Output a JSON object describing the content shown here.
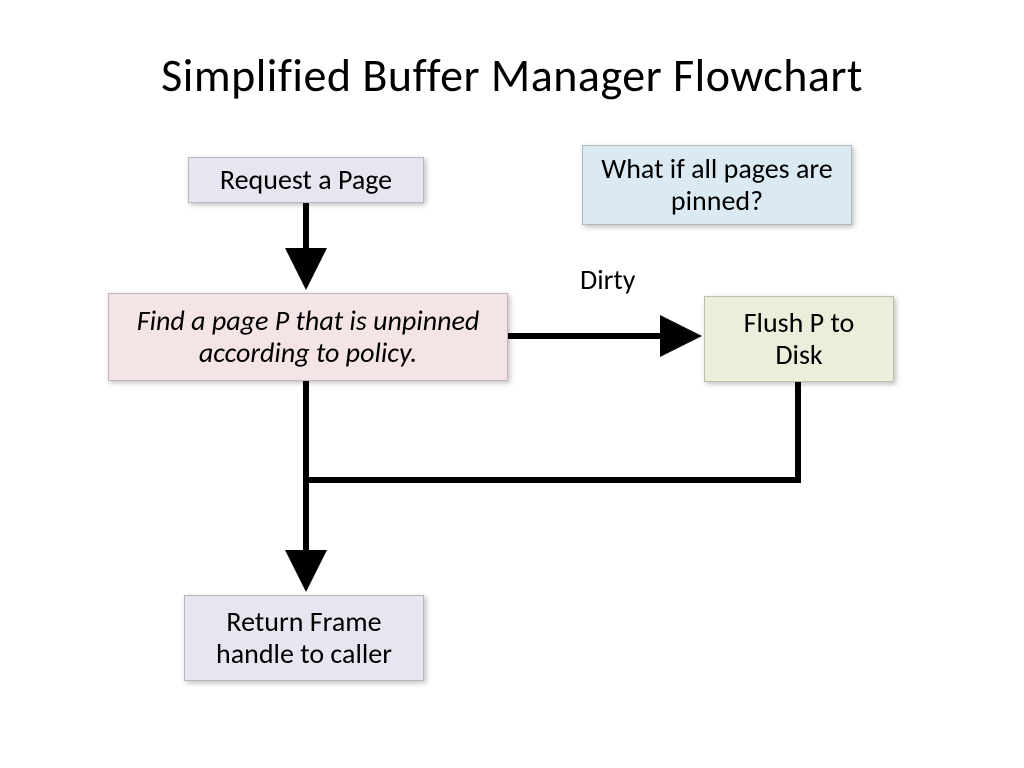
{
  "title": "Simplified Buffer Manager Flowchart",
  "nodes": {
    "request": "Request a Page",
    "note": "What if all pages are pinned?",
    "find": "Find a page P that is unpinned according to policy.",
    "flush": "Flush P to Disk",
    "return": "Return Frame handle to caller"
  },
  "edges": {
    "dirty": "Dirty"
  }
}
